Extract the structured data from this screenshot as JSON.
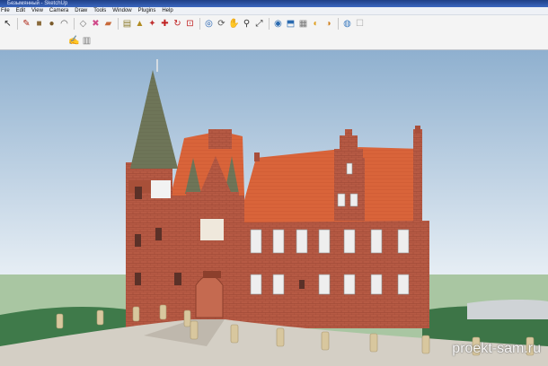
{
  "window": {
    "title": "Безымянный - SketchUp"
  },
  "menu": [
    "File",
    "Edit",
    "View",
    "Camera",
    "Draw",
    "Tools",
    "Window",
    "Plugins",
    "Help"
  ],
  "toolbar": {
    "row1": [
      {
        "icon": "select-arrow-icon",
        "glyph": "↖",
        "color": "#222222"
      },
      {
        "icon": "pencil-icon",
        "glyph": "✎",
        "color": "#b02a1a"
      },
      {
        "icon": "rectangle-icon",
        "glyph": "■",
        "color": "#8a6a3a"
      },
      {
        "icon": "circle-icon",
        "glyph": "●",
        "color": "#7a5a2a"
      },
      {
        "icon": "arc-icon",
        "glyph": "◠",
        "color": "#555555"
      },
      {
        "icon": "make-component-icon",
        "glyph": "◇",
        "color": "#777777"
      },
      {
        "icon": "eraser-icon",
        "glyph": "✖",
        "color": "#d04a8a"
      },
      {
        "icon": "paint-bucket-icon",
        "glyph": "▰",
        "color": "#c86a3a"
      },
      {
        "icon": "tape-measure-icon",
        "glyph": "▤",
        "color": "#8a7a2a"
      },
      {
        "icon": "push-pull-icon",
        "glyph": "▲",
        "color": "#b08a20"
      },
      {
        "icon": "follow-me-icon",
        "glyph": "✦",
        "color": "#c03030"
      },
      {
        "icon": "move-icon",
        "glyph": "✚",
        "color": "#c02020"
      },
      {
        "icon": "rotate-icon",
        "glyph": "↻",
        "color": "#c02020"
      },
      {
        "icon": "scale-icon",
        "glyph": "⊡",
        "color": "#c02020"
      },
      {
        "icon": "offset-icon",
        "glyph": "◎",
        "color": "#1f5fb0"
      },
      {
        "icon": "orbit-icon",
        "glyph": "⟳",
        "color": "#555555"
      },
      {
        "icon": "pan-icon",
        "glyph": "✋",
        "color": "#555555"
      },
      {
        "icon": "zoom-icon",
        "glyph": "⚲",
        "color": "#333333"
      },
      {
        "icon": "zoom-extents-icon",
        "glyph": "⤢",
        "color": "#333333"
      },
      {
        "icon": "get-models-icon",
        "glyph": "◉",
        "color": "#2a6ab0"
      },
      {
        "icon": "share-model-icon",
        "glyph": "⬒",
        "color": "#2a6ab0"
      },
      {
        "icon": "components-icon",
        "glyph": "▦",
        "color": "#777777"
      },
      {
        "icon": "materials-icon",
        "glyph": "◐",
        "color": "#e0a020"
      },
      {
        "icon": "styles-icon",
        "glyph": "◑",
        "color": "#d08020"
      },
      {
        "icon": "google-earth-icon",
        "glyph": "◍",
        "color": "#3a7ac0"
      },
      {
        "icon": "shadows-icon",
        "glyph": "☐",
        "color": "#aaaaaa"
      }
    ],
    "row2": [
      {
        "icon": "walk-icon",
        "glyph": "✍",
        "color": "#2a4aa0"
      },
      {
        "icon": "section-plane-icon",
        "glyph": "▥",
        "color": "#777777"
      }
    ]
  },
  "watermark": {
    "text": "proekt-sam.ru"
  },
  "colors": {
    "sky_top": "#8fb0cf",
    "sky_bottom": "#e6eef5",
    "grass": "#a9c6a2",
    "brick": "#b65a44",
    "roof": "#d9643a",
    "spire": "#6e7558",
    "path": "#d4cfc5"
  }
}
